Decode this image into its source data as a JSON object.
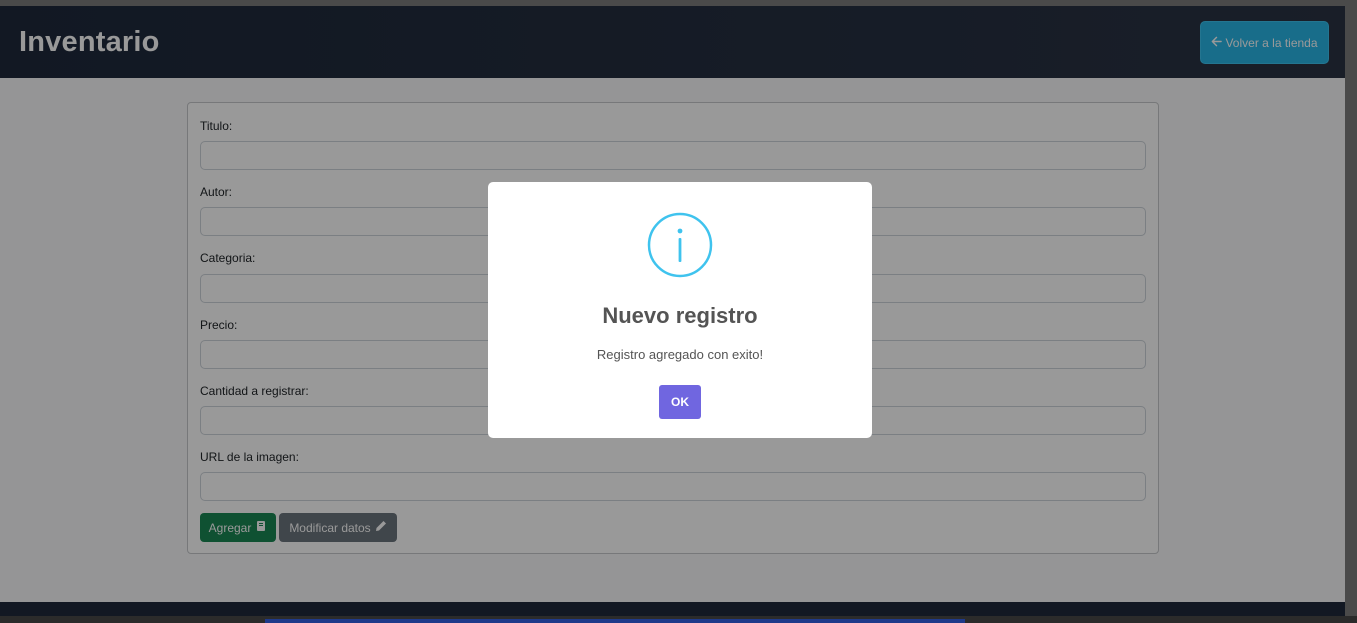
{
  "header": {
    "title": "Inventario",
    "back_button_label": "Volver a la tienda",
    "back_icon": "arrow-left-icon"
  },
  "form": {
    "fields": [
      {
        "label": "Titulo:",
        "value": ""
      },
      {
        "label": "Autor:",
        "value": ""
      },
      {
        "label": "Categoria:",
        "value": ""
      },
      {
        "label": "Precio:",
        "value": ""
      },
      {
        "label": "Cantidad a registrar:",
        "value": ""
      },
      {
        "label": "URL de la imagen:",
        "value": ""
      }
    ],
    "add_button_label": "Agregar",
    "add_icon": "book-icon",
    "modify_button_label": "Modificar datos",
    "modify_icon": "pencil-icon"
  },
  "modal": {
    "icon": "info-icon",
    "title": "Nuevo registro",
    "message": "Registro agregado con exito!",
    "ok_label": "OK"
  },
  "colors": {
    "header_bg": "#1e293b",
    "back_button": "#29b6e6",
    "add_button": "#198754",
    "modify_button": "#6c757d",
    "ok_button": "#7066e0",
    "info_icon": "#3fc3ee"
  }
}
